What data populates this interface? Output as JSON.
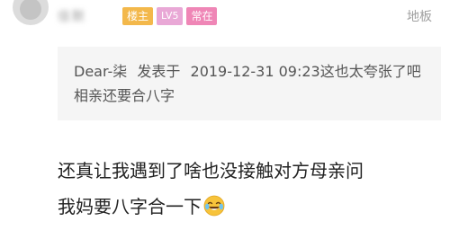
{
  "post": {
    "username": "佳默",
    "badges": {
      "op": "楼主",
      "level": "LV5",
      "regular": "常在"
    },
    "floor": "地板",
    "quote": {
      "author": "Dear-柒",
      "action": "发表于",
      "timestamp": "2019-12-31 09:23",
      "text": "这也太夸张了吧 相亲还要合八字"
    },
    "content": {
      "line1": "还真让我遇到了啥也没接触对方母亲问",
      "line2": "我妈要八字合一下",
      "emoji_icon": "laugh-crying-emoji-icon"
    },
    "colors": {
      "badge_op": "#f3b84b",
      "badge_level": "#e9a8d6",
      "badge_regular": "#ef86b6",
      "quote_bg": "#f5f5f5"
    }
  }
}
